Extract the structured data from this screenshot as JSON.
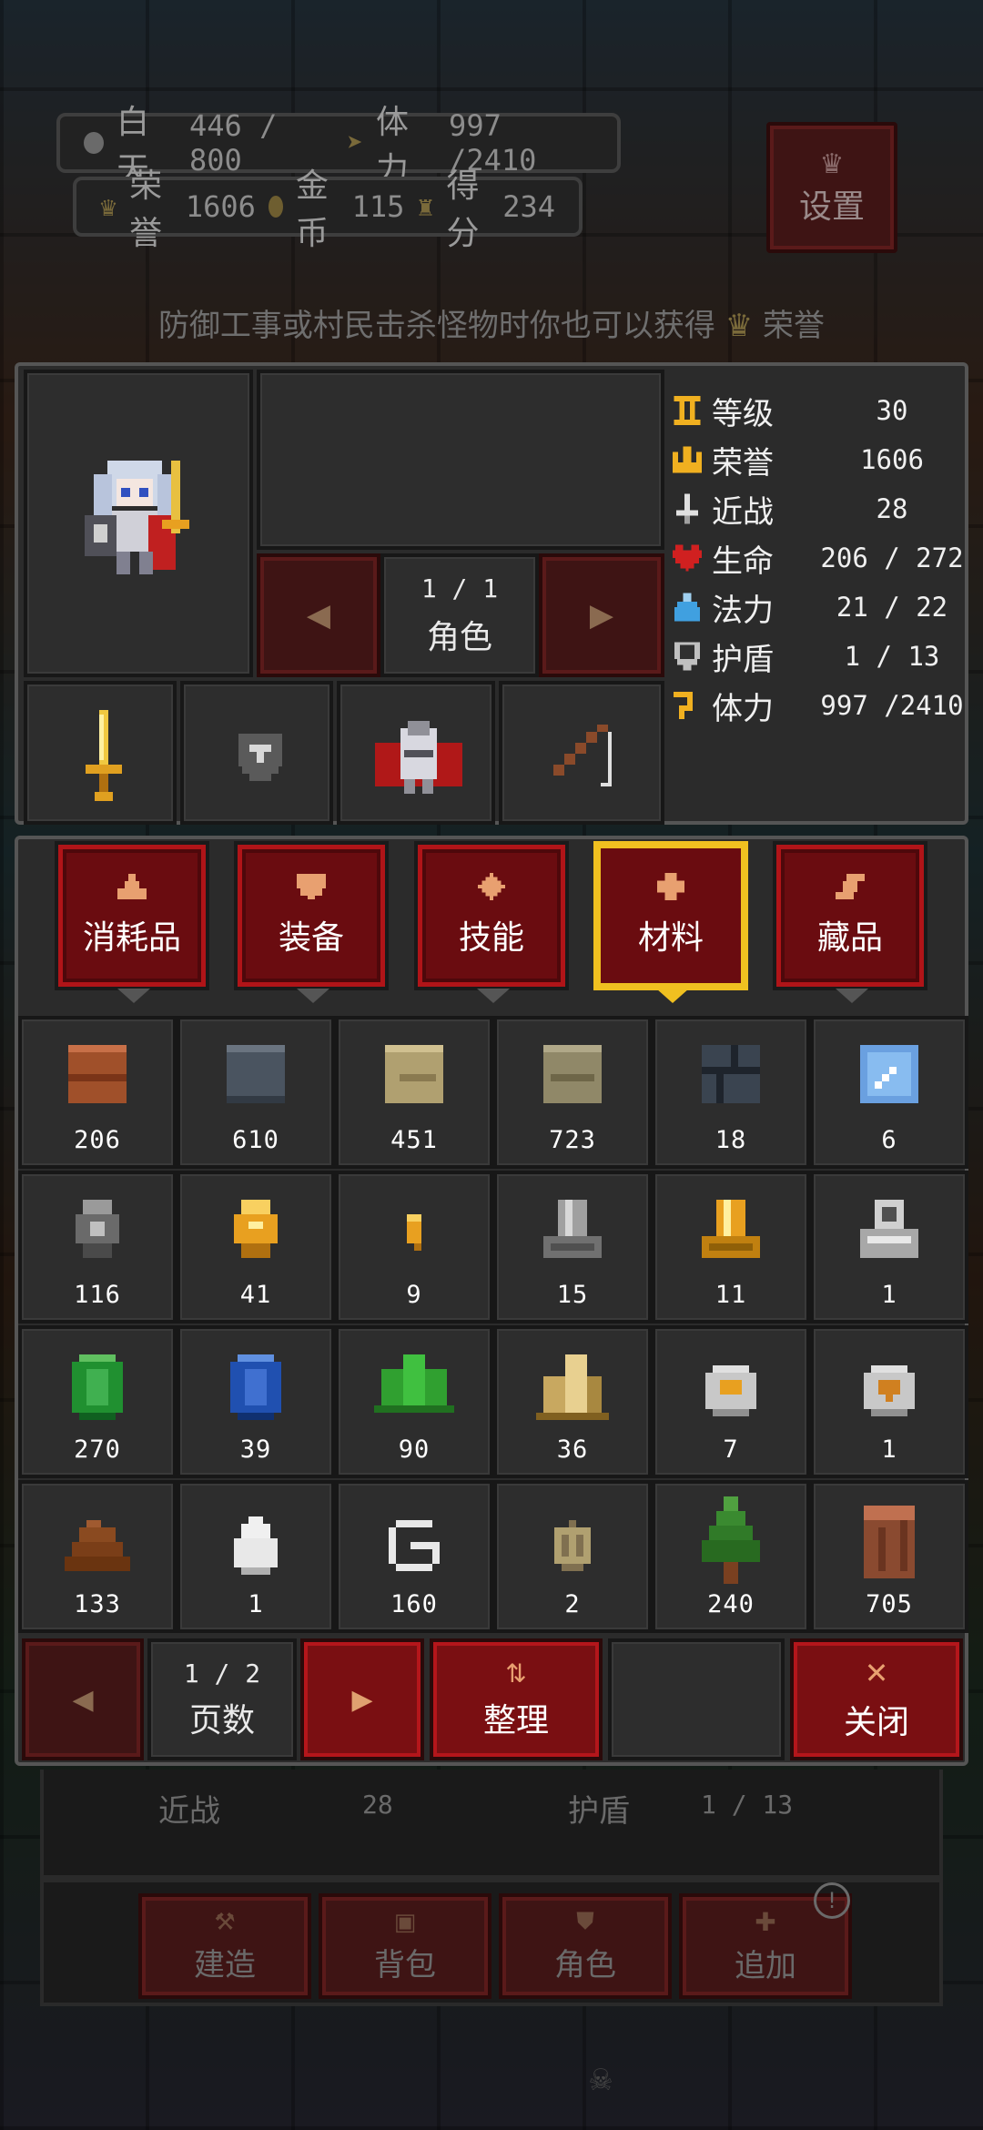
{
  "hud": {
    "day_label": "白天",
    "day_value": "446 / 800",
    "stamina_label": "体力",
    "stamina_value": "997 /2410",
    "honor_label": "荣誉",
    "honor_value": "1606",
    "gold_label": "金币",
    "gold_value": "115",
    "score_label": "得分",
    "score_value": "234",
    "settings_label": "设置"
  },
  "hint": {
    "text_before": "防御工事或村民击杀怪物时你也可以获得",
    "text_after": "荣誉"
  },
  "character": {
    "page": "1 / 1",
    "page_label": "角色",
    "equipment": [
      "golden-sword",
      "shield",
      "red-cape-armor",
      "fishing-rod"
    ]
  },
  "stats": [
    {
      "icon": "level-icon",
      "name": "等级",
      "value": "30",
      "color": "#f0b020"
    },
    {
      "icon": "honor-crown-icon",
      "name": "荣誉",
      "value": "1606",
      "color": "#f0b020"
    },
    {
      "icon": "melee-icon",
      "name": "近战",
      "value": "28",
      "color": "#e0e0e0"
    },
    {
      "icon": "heart-icon",
      "name": "生命",
      "value": "206 / 272",
      "color": "#d02020"
    },
    {
      "icon": "potion-icon",
      "name": "法力",
      "value": "21 / 22",
      "color": "#40a0e0"
    },
    {
      "icon": "shield-icon",
      "name": "护盾",
      "value": "1 / 13",
      "color": "#c0c0c0"
    },
    {
      "icon": "stamina-icon",
      "name": "体力",
      "value": "997 /2410",
      "color": "#f0b020"
    }
  ],
  "tabs": [
    {
      "label": "消耗品",
      "icon": "flask-icon"
    },
    {
      "label": "装备",
      "icon": "armor-icon"
    },
    {
      "label": "技能",
      "icon": "diamond-icon"
    },
    {
      "label": "材料",
      "icon": "material-icon",
      "selected": true
    },
    {
      "label": "藏品",
      "icon": "scroll-icon"
    }
  ],
  "items": [
    {
      "icon": "brick-icon",
      "qty": "206"
    },
    {
      "icon": "stone-block-icon",
      "qty": "610"
    },
    {
      "icon": "sandstone-icon",
      "qty": "451"
    },
    {
      "icon": "mossy-stone-icon",
      "qty": "723"
    },
    {
      "icon": "stone-brick-icon",
      "qty": "18"
    },
    {
      "icon": "glass-icon",
      "qty": "6"
    },
    {
      "icon": "coal-ore-icon",
      "qty": "116"
    },
    {
      "icon": "gold-ore-icon",
      "qty": "41"
    },
    {
      "icon": "gold-nugget-icon",
      "qty": "9"
    },
    {
      "icon": "iron-ingot-icon",
      "qty": "15"
    },
    {
      "icon": "gold-ingot-icon",
      "qty": "11"
    },
    {
      "icon": "machine-part-icon",
      "qty": "1"
    },
    {
      "icon": "emerald-icon",
      "qty": "270"
    },
    {
      "icon": "sapphire-icon",
      "qty": "39"
    },
    {
      "icon": "green-crystal-icon",
      "qty": "90"
    },
    {
      "icon": "topaz-crystal-icon",
      "qty": "36"
    },
    {
      "icon": "bone-coin-icon",
      "qty": "7"
    },
    {
      "icon": "skull-coin-icon",
      "qty": "1"
    },
    {
      "icon": "dung-icon",
      "qty": "133"
    },
    {
      "icon": "egg-icon",
      "qty": "1"
    },
    {
      "icon": "string-icon",
      "qty": "160"
    },
    {
      "icon": "seed-icon",
      "qty": "2"
    },
    {
      "icon": "tree-icon",
      "qty": "240"
    },
    {
      "icon": "log-icon",
      "qty": "705"
    }
  ],
  "pager": {
    "page": "1 / 2",
    "page_label": "页数",
    "sort_label": "整理",
    "close_label": "关闭"
  },
  "background_panel": {
    "melee_label": "近战",
    "melee_value": "28",
    "shield_label": "护盾",
    "shield_value": "1 / 13",
    "nav": [
      "建造",
      "背包",
      "角色",
      "追加"
    ]
  }
}
